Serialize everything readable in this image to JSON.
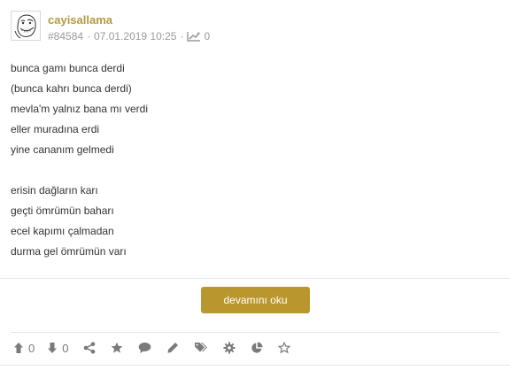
{
  "post": {
    "author": "cayisallama",
    "id": "#84584",
    "date": "07.01.2019 10:25",
    "separator": "·",
    "view_count": "0",
    "icons": {
      "avatar": "troll-face-avatar",
      "trend": "trend-chart-icon"
    }
  },
  "content": {
    "lines": [
      "bunca gamı bunca derdi",
      "(bunca kahrı bunca derdi)",
      "mevla'm yalnız bana mı verdi",
      "eller muradına erdi",
      "yine cananım gelmedi",
      "",
      "erisin dağların karı",
      "geçti ömrümün baharı",
      "ecel kapımı çalmadan",
      "durma gel ömrümün varı"
    ]
  },
  "actions": {
    "more_label": "devamını oku",
    "upvote_count": "0",
    "downvote_count": "0",
    "icons": [
      "arrow-up-icon",
      "arrow-down-icon",
      "share-icon",
      "star-icon",
      "comment-icon",
      "pencil-icon",
      "tags-icon",
      "gear-icon",
      "pie-chart-icon",
      "star-outline-icon"
    ]
  },
  "colors": {
    "accent": "#b9972e",
    "author": "#b39a3f",
    "meta": "#9a9a9a",
    "icon": "#7a7a7a",
    "text": "#333333",
    "divider": "#e6e6e6"
  }
}
